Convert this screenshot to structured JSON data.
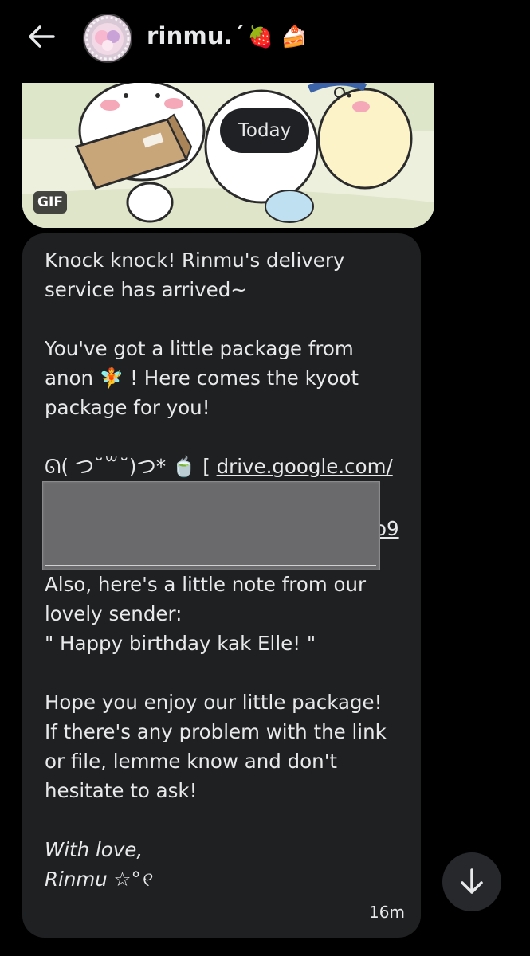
{
  "header": {
    "title": "rinmu.ˊ",
    "title_emoji": "🍓 🍰",
    "back_icon": "arrow-left-icon",
    "avatar_icon": "avatar"
  },
  "media": {
    "badge": "GIF",
    "date_separator": "Today"
  },
  "message": {
    "line1": "Knock knock! Rinmu's delivery",
    "line2": "service has arrived~",
    "line3": "You've got a little package from",
    "line4_a": "anon",
    "line4_emoji": "🧚",
    "line4_b": " ! Here comes the kyoot",
    "line5": "package for you!",
    "kaomoji": "ᘏ( つ˘꒳˘)つ* 🍵",
    "link_bracket": " [ ",
    "link_text": "drive.google.com/",
    "link_tail": "o9",
    "note1": "Also, here's a little note from our",
    "note2": "lovely sender:",
    "note3": "\" Happy birthday kak Elle! \"",
    "closing1": "Hope you enjoy our little package!",
    "closing2": "If there's any problem with the link",
    "closing3": "or file, lemme know and don't",
    "closing4": "hesitate to ask!",
    "sign1": "With love,",
    "sign2": "Rinmu ☆°୧",
    "timestamp": "16m"
  },
  "scroll_button_icon": "arrow-down-icon",
  "colors": {
    "background": "#000000",
    "bubble": "#1f2022",
    "text": "#e7e9ea"
  }
}
